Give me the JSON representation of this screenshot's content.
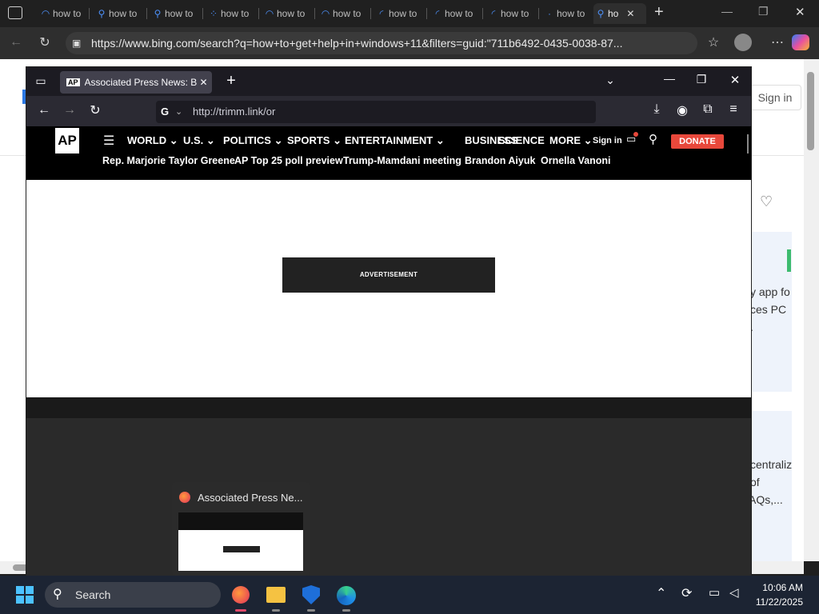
{
  "edge": {
    "tabs": [
      "how to",
      "how to",
      "how to",
      "how to",
      "how to",
      "how to",
      "how to",
      "how to",
      "how to",
      "ho"
    ],
    "url": "https://www.bing.com/search?q=how+to+get+help+in+windows+11&filters=guid:\"711b6492-0435-0038-87...",
    "sign_in": "Sign in",
    "side_texts": [
      "y app fo",
      "ces PC",
      ".",
      "centraliz",
      "of",
      "AQs,..."
    ]
  },
  "firefox": {
    "tab_title": "Associated Press News: Breaking",
    "url": "http://trimm.link/or",
    "ap": {
      "logo": "AP",
      "nav": [
        "WORLD",
        "U.S.",
        "POLITICS",
        "SPORTS",
        "ENTERTAINMENT",
        "BUSINESS",
        "SCIENCE",
        "MORE"
      ],
      "sign_in": "Sign in",
      "donate": "DONATE",
      "trending": [
        "Rep. Marjorie Taylor Greene",
        "AP Top 25 poll preview",
        "Trump-Mamdani meeting",
        "Brandon Aiyuk",
        "Ornella Vanoni"
      ],
      "ad_label": "ADVERTISEMENT"
    }
  },
  "preview": {
    "title": "Associated Press Ne..."
  },
  "taskbar": {
    "search": "Search",
    "time": "10:06 AM",
    "date": "11/22/2025"
  },
  "colors": {
    "donate": "#e8483b",
    "edge_tab_icon": "#4c8ef5"
  }
}
